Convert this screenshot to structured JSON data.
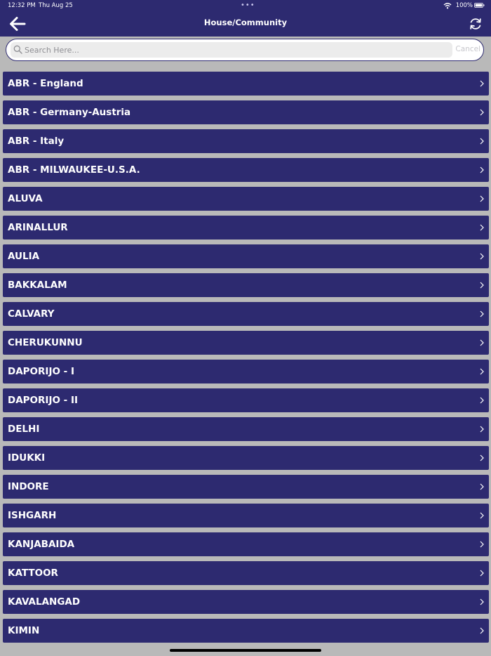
{
  "status_bar": {
    "time": "12:32 PM",
    "date": "Thu Aug 25",
    "battery": "100%"
  },
  "header": {
    "title": "House/Community",
    "back_icon": "arrow-left-icon",
    "refresh_icon": "refresh-icon"
  },
  "search": {
    "placeholder": "Search Here...",
    "value": "",
    "cancel_label": "Cancel"
  },
  "colors": {
    "accent": "#2d2a70",
    "background": "#b9b9b9"
  },
  "communities": [
    {
      "label": "ABR - England"
    },
    {
      "label": "ABR - Germany-Austria"
    },
    {
      "label": "ABR - Italy"
    },
    {
      "label": "ABR - MILWAUKEE-U.S.A."
    },
    {
      "label": "ALUVA"
    },
    {
      "label": "ARINALLUR"
    },
    {
      "label": "AULIA"
    },
    {
      "label": "BAKKALAM"
    },
    {
      "label": "CALVARY"
    },
    {
      "label": "CHERUKUNNU"
    },
    {
      "label": "DAPORIJO - I"
    },
    {
      "label": "DAPORIJO - II"
    },
    {
      "label": "DELHI"
    },
    {
      "label": "IDUKKI"
    },
    {
      "label": "INDORE"
    },
    {
      "label": "ISHGARH"
    },
    {
      "label": "KANJABAIDA"
    },
    {
      "label": "KATTOOR"
    },
    {
      "label": "KAVALANGAD"
    },
    {
      "label": "KIMIN"
    }
  ]
}
